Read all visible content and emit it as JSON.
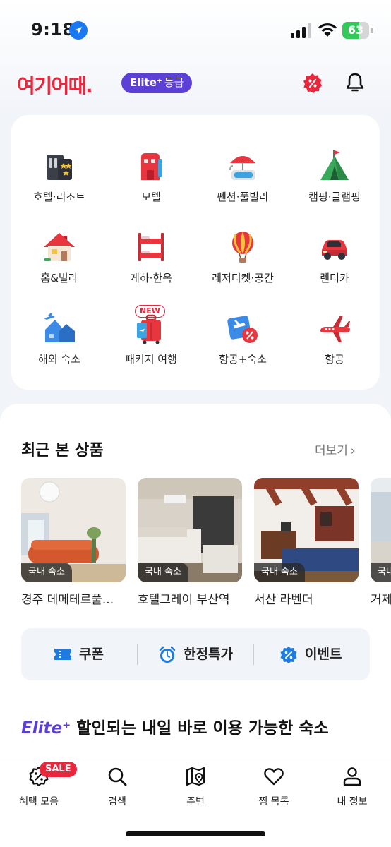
{
  "status_bar": {
    "time": "9:18",
    "battery_level": "63",
    "battery_fraction": 0.63
  },
  "header": {
    "logo_text": "여기어때.",
    "elite_label": "Elite⁺",
    "grade_label": "등급",
    "icons": [
      "coupon-icon",
      "bell-icon"
    ]
  },
  "categories": [
    {
      "label": "호텔·리조트",
      "icon": "hotel-icon"
    },
    {
      "label": "모텔",
      "icon": "motel-icon"
    },
    {
      "label": "펜션·풀빌라",
      "icon": "pool-villa-icon"
    },
    {
      "label": "캠핑·글램핑",
      "icon": "tent-icon"
    },
    {
      "label": "홈&빌라",
      "icon": "house-icon"
    },
    {
      "label": "게하·한옥",
      "icon": "bunk-bed-icon"
    },
    {
      "label": "레저티켓·공간",
      "icon": "balloon-icon"
    },
    {
      "label": "렌터카",
      "icon": "car-icon"
    },
    {
      "label": "해외 숙소",
      "icon": "overseas-icon"
    },
    {
      "label": "패키지 여행",
      "icon": "luggage-icon",
      "badge": "NEW"
    },
    {
      "label": "항공+숙소",
      "icon": "flight-hotel-icon"
    },
    {
      "label": "항공",
      "icon": "airplane-icon"
    }
  ],
  "recent": {
    "title": "최근 본 상품",
    "more_label": "더보기",
    "items": [
      {
        "badge": "국내 숙소",
        "name": "경주 데메테르풀..."
      },
      {
        "badge": "국내 숙소",
        "name": "호텔그레이 부산역"
      },
      {
        "badge": "국내 숙소",
        "name": "서산 라벤더"
      },
      {
        "badge": "국내",
        "name": "거제"
      }
    ]
  },
  "quick_links": [
    {
      "label": "쿠폰",
      "icon": "ticket-icon"
    },
    {
      "label": "한정특가",
      "icon": "alarm-clock-icon"
    },
    {
      "label": "이벤트",
      "icon": "percent-badge-icon"
    }
  ],
  "elite_section": {
    "brand": "Elite⁺",
    "title": "할인되는 내일 바로 이용 가능한 숙소"
  },
  "bottom_nav": [
    {
      "label": "혜택 모음",
      "icon": "benefit-icon",
      "badge": "SALE"
    },
    {
      "label": "검색",
      "icon": "search-icon"
    },
    {
      "label": "주변",
      "icon": "map-icon"
    },
    {
      "label": "찜 목록",
      "icon": "heart-icon"
    },
    {
      "label": "내 정보",
      "icon": "person-icon"
    }
  ],
  "colors": {
    "brand_red": "#e8263c",
    "elite_purple": "#5b3fd6",
    "quick_blue": "#1f7ae0",
    "background": "#f1f4f9"
  }
}
